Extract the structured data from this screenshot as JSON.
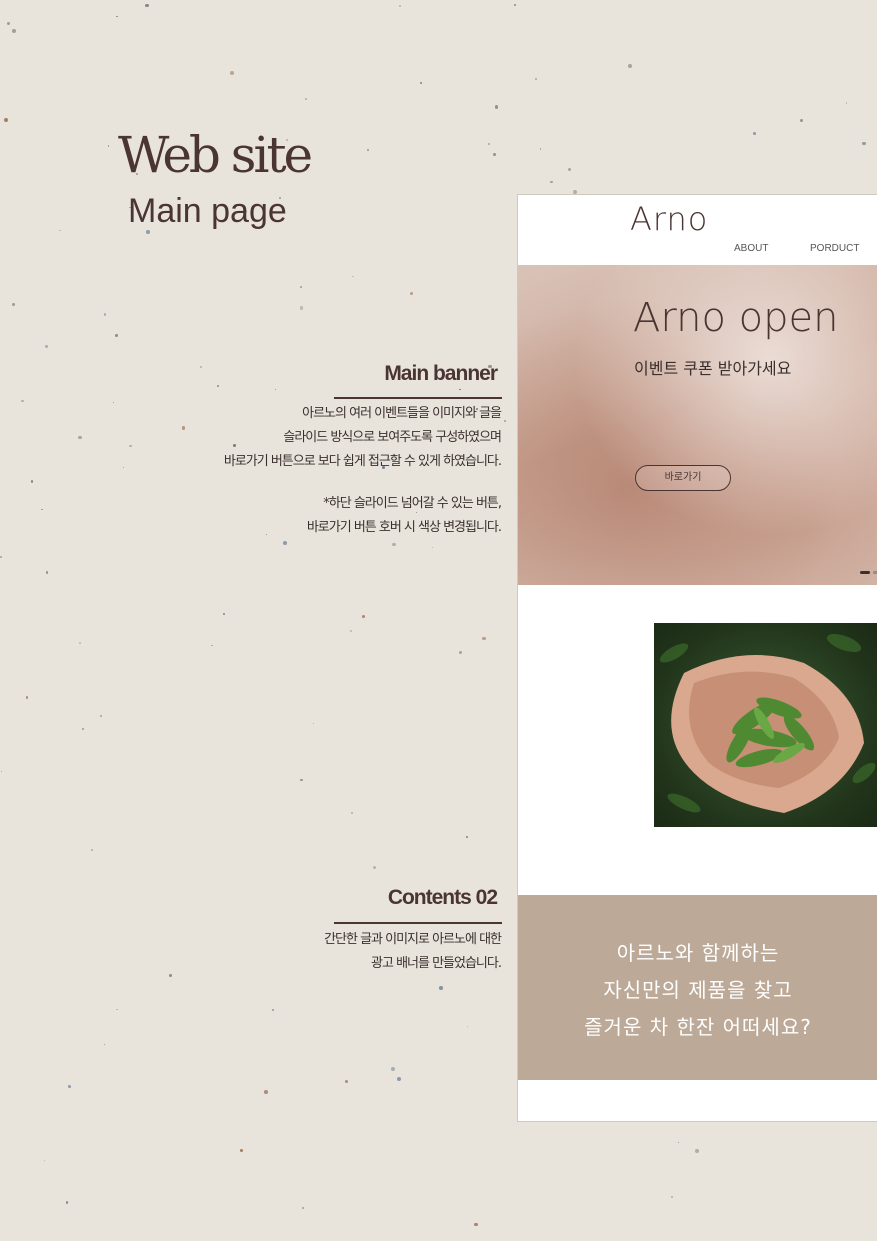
{
  "heading": {
    "title": "Web site",
    "subtitle": "Main page"
  },
  "notes": {
    "main_banner": {
      "title": "Main banner",
      "lines": [
        "아르노의 여러 이벤트들을 이미지와 글을",
        "슬라이드 방식으로 보여주도록 구성하였으며",
        "바로가기 버튼으로 보다 쉽게 접근할 수 있게 하였습니다."
      ],
      "extra_lines": [
        "*하단 슬라이드 넘어갈 수 있는 버튼,",
        "바로가기 버튼 호버 시 색상 변경됩니다."
      ]
    },
    "contents_02": {
      "title": "Contents 02",
      "lines": [
        "간단한 글과 이미지로 아르노에 대한",
        "광고 배너를 만들었습니다."
      ]
    }
  },
  "mockup": {
    "logo": "Arno",
    "nav": [
      "ABOUT",
      "PORDUCT"
    ],
    "banner": {
      "title": "Arno open",
      "subtitle": "이벤트 쿠폰 받아가세요",
      "button": "바로가기",
      "active_dot_color": "#3a2f2d"
    },
    "promo": {
      "lines": [
        "아르노와 함께하는",
        "자신만의 제품을 찾고",
        "즐거운 차 한잔 어떠세요?"
      ],
      "background": "#bca998"
    }
  },
  "colors": {
    "accent": "#4a3533",
    "paper": "#e8e4dc"
  }
}
